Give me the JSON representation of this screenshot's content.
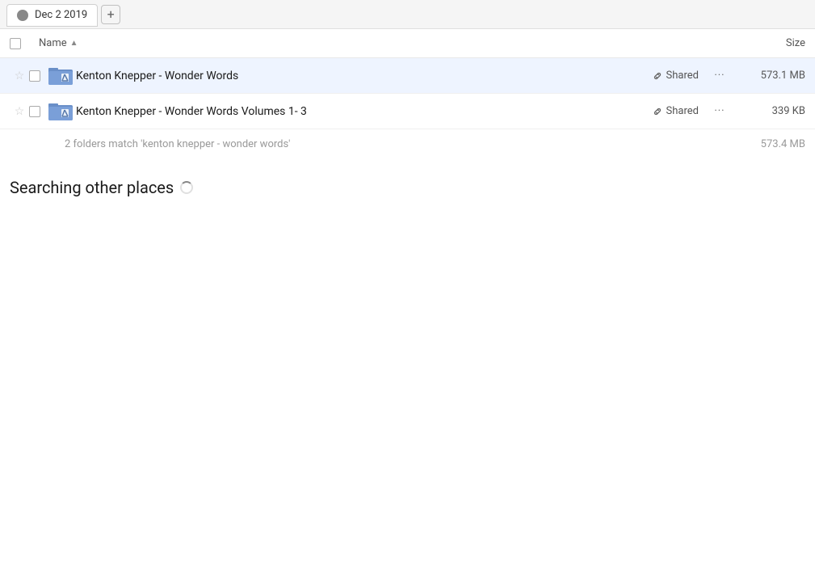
{
  "tab": {
    "label": "Dec 2 2019",
    "add_button": "+"
  },
  "columns": {
    "name_label": "Name",
    "size_label": "Size"
  },
  "rows": [
    {
      "id": "row-1",
      "name": "Kenton Knepper - Wonder Words",
      "shared_label": "Shared",
      "size": "573.1 MB",
      "starred": false,
      "highlighted": true
    },
    {
      "id": "row-2",
      "name": "Kenton Knepper - Wonder Words Volumes 1- 3",
      "shared_label": "Shared",
      "size": "339 KB",
      "starred": false,
      "highlighted": false
    }
  ],
  "summary": {
    "text": "2 folders match 'kenton knepper - wonder words'",
    "size": "573.4 MB"
  },
  "searching": {
    "title": "Searching other places"
  },
  "icons": {
    "star": "☆",
    "star_filled": "★",
    "link": "🔗",
    "more": "···",
    "sort_asc": "▲"
  }
}
